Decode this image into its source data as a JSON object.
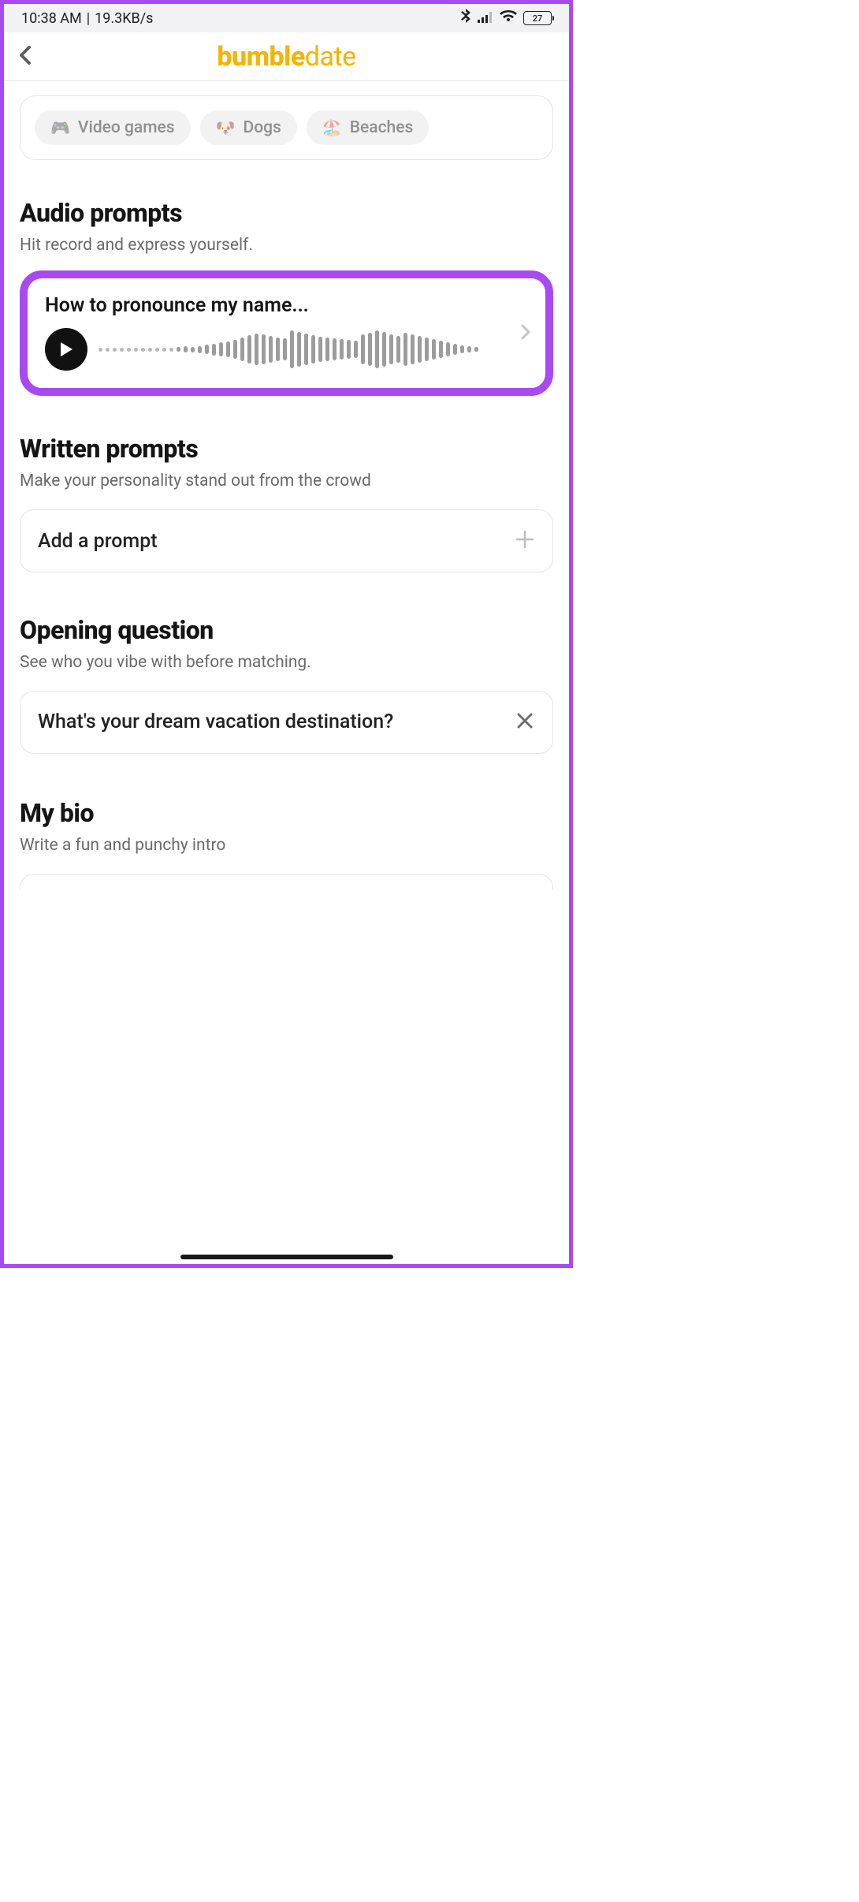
{
  "status": {
    "time": "10:38 AM",
    "sep": "|",
    "rate": "19.3KB/s",
    "battery_pct": "27"
  },
  "header": {
    "brand_main": "bumble",
    "brand_sub": "date"
  },
  "interests": {
    "items": [
      {
        "icon": "gamepad-icon",
        "label": "Video games"
      },
      {
        "icon": "dog-icon",
        "label": "Dogs"
      },
      {
        "icon": "beach-icon",
        "label": "Beaches"
      }
    ]
  },
  "audio": {
    "title": "Audio prompts",
    "subtitle": "Hit record and express yourself.",
    "prompt_title": "How to pronounce my name..."
  },
  "written": {
    "title": "Written prompts",
    "subtitle": "Make your personality stand out from the crowd",
    "add_label": "Add a prompt"
  },
  "opening": {
    "title": "Opening question",
    "subtitle": "See who you vibe with before matching.",
    "question": "What's your dream vacation destination?"
  },
  "bio": {
    "title": "My bio",
    "subtitle": "Write a fun and punchy intro"
  }
}
